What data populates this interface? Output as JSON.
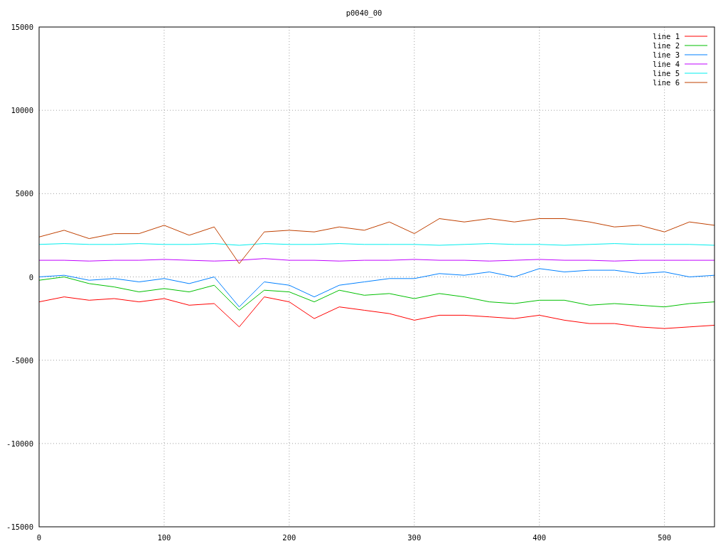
{
  "chart_data": {
    "type": "line",
    "title": "p0040_00",
    "grid": true,
    "legend": true,
    "xlim": [
      0,
      540
    ],
    "ylim": [
      -15000,
      15000
    ],
    "xticks": [
      0,
      100,
      200,
      300,
      400,
      500
    ],
    "yticks": [
      -15000,
      -10000,
      -5000,
      0,
      5000,
      10000,
      15000
    ],
    "x": [
      0,
      20,
      40,
      60,
      80,
      100,
      120,
      140,
      160,
      180,
      200,
      220,
      240,
      260,
      280,
      300,
      320,
      340,
      360,
      380,
      400,
      420,
      440,
      460,
      480,
      500,
      520,
      540
    ],
    "series": [
      {
        "name": "line 1",
        "color": "#ff0000",
        "values": [
          -1500,
          -1200,
          -1400,
          -1300,
          -1500,
          -1300,
          -1700,
          -1600,
          -3000,
          -1200,
          -1500,
          -2500,
          -1800,
          -2000,
          -2200,
          -2600,
          -2300,
          -2300,
          -2400,
          -2500,
          -2300,
          -2600,
          -2800,
          -2800,
          -3000,
          -3100,
          -3000,
          -2900
        ]
      },
      {
        "name": "line 2",
        "color": "#00c000",
        "values": [
          -200,
          0,
          -400,
          -600,
          -900,
          -700,
          -900,
          -500,
          -2000,
          -800,
          -900,
          -1500,
          -800,
          -1100,
          -1000,
          -1300,
          -1000,
          -1200,
          -1500,
          -1600,
          -1400,
          -1400,
          -1700,
          -1600,
          -1700,
          -1800,
          -1600,
          -1500
        ]
      },
      {
        "name": "line 3",
        "color": "#0080ff",
        "values": [
          0,
          100,
          -200,
          -100,
          -300,
          -100,
          -400,
          0,
          -1800,
          -300,
          -500,
          -1200,
          -500,
          -300,
          -100,
          -100,
          200,
          100,
          300,
          0,
          500,
          300,
          400,
          400,
          200,
          300,
          0,
          100
        ]
      },
      {
        "name": "line 4",
        "color": "#c000ff",
        "values": [
          1000,
          1000,
          950,
          1000,
          1000,
          1050,
          1000,
          950,
          1000,
          1100,
          1000,
          1000,
          950,
          1000,
          1000,
          1050,
          1000,
          1000,
          950,
          1000,
          1050,
          1000,
          1000,
          950,
          1000,
          1000,
          1000,
          1000
        ]
      },
      {
        "name": "line 5",
        "color": "#00eeee",
        "values": [
          1950,
          2000,
          1950,
          1950,
          2000,
          1950,
          1950,
          2000,
          1900,
          2000,
          1950,
          1950,
          2000,
          1950,
          1950,
          1950,
          1900,
          1950,
          2000,
          1950,
          1950,
          1900,
          1950,
          2000,
          1950,
          1950,
          1950,
          1900
        ]
      },
      {
        "name": "line 6",
        "color": "#c04000",
        "values": [
          2400,
          2800,
          2300,
          2600,
          2600,
          3100,
          2500,
          3000,
          800,
          2700,
          2800,
          2700,
          3000,
          2800,
          3300,
          2600,
          3500,
          3300,
          3500,
          3300,
          3500,
          3500,
          3300,
          3000,
          3100,
          2700,
          3300,
          3100
        ]
      }
    ]
  }
}
